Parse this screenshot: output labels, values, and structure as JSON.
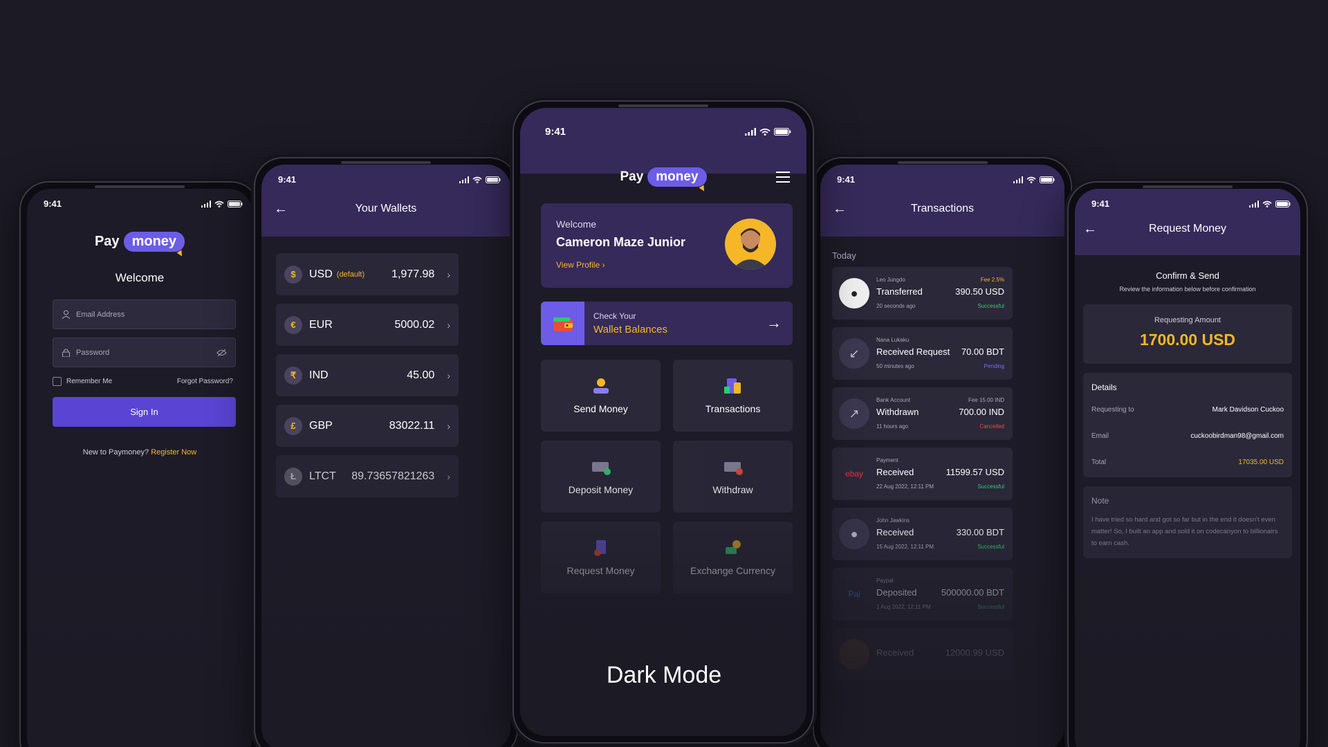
{
  "caption": "Dark Mode",
  "status_time": "9:41",
  "logo": {
    "pay": "Pay",
    "money": "money"
  },
  "login": {
    "welcome": "Welcome",
    "email_placeholder": "Email Address",
    "password_placeholder": "Password",
    "remember": "Remember Me",
    "forgot": "Forgot Password?",
    "sign_in": "Sign In",
    "new_text": "New to Paymoney?",
    "register": "Register Now"
  },
  "wallets": {
    "title": "Your Wallets",
    "items": [
      {
        "symbol": "$",
        "code": "USD",
        "tag": "(default)",
        "amount": "1,977.98"
      },
      {
        "symbol": "€",
        "code": "EUR",
        "tag": "",
        "amount": "5000.02"
      },
      {
        "symbol": "₹",
        "code": "IND",
        "tag": "",
        "amount": "45.00"
      },
      {
        "symbol": "£",
        "code": "GBP",
        "tag": "",
        "amount": "83022.11"
      },
      {
        "symbol": "Ł",
        "code": "LTCT",
        "tag": "",
        "amount": "89.73657821263"
      }
    ]
  },
  "home": {
    "welcome": "Welcome",
    "name": "Cameron Maze Junior",
    "view_profile": "View Profile ›",
    "check_your": "Check Your",
    "wallet_balances": "Wallet Balances",
    "actions": [
      "Send Money",
      "Transactions",
      "Deposit Money",
      "Withdraw",
      "Request Money",
      "Exchange Currency"
    ]
  },
  "transactions": {
    "title": "Transactions",
    "section": "Today",
    "items": [
      {
        "party": "Leo Jungdo",
        "type": "Transferred",
        "time": "20 seconds ago",
        "fee": "Fee 2.5%",
        "amount": "390.50 USD",
        "status": "Successful"
      },
      {
        "party": "Nana Lukaku",
        "type": "Received Request",
        "time": "50 minutes ago",
        "fee": "",
        "amount": "70.00 BDT",
        "status": "Pending"
      },
      {
        "party": "Bank Account",
        "type": "Withdrawn",
        "time": "11 hours ago",
        "fee": "Fee 15.00 IND",
        "amount": "700.00 IND",
        "status": "Cancelled"
      },
      {
        "party": "Payment",
        "type": "Received",
        "time": "22 Aug 2022, 12:11 PM",
        "fee": "",
        "amount": "11599.57 USD",
        "status": "Successful"
      },
      {
        "party": "John Jawkins",
        "type": "Received",
        "time": "15 Aug 2022, 12:11 PM",
        "fee": "",
        "amount": "330.00 BDT",
        "status": "Successful"
      },
      {
        "party": "Paypal",
        "type": "Deposited",
        "time": "1 Aug 2022, 12:11 PM",
        "fee": "",
        "amount": "500000.00 BDT",
        "status": "Successful"
      },
      {
        "party": "",
        "type": "Received",
        "time": "",
        "fee": "",
        "amount": "12000.99 USD",
        "status": ""
      }
    ]
  },
  "request": {
    "title": "Request Money",
    "confirm": "Confirm & Send",
    "confirm_sub": "Review the information below before confirmation",
    "req_label": "Requesting Amount",
    "req_amount": "1700.00 USD",
    "details": "Details",
    "rows": [
      {
        "label": "Requesting to",
        "value": "Mark Davidson Cuckoo"
      },
      {
        "label": "Email",
        "value": "cuckoobirdman98@gmail.com"
      },
      {
        "label": "Total",
        "value": "17035.00 USD"
      }
    ],
    "note_label": "Note",
    "note_text": "I have tried so hard and got so far but in the end it doesn't even matter! So, I built an app and sold it on codecanyon to billionairs to earn cash."
  },
  "colors": {
    "bg": "#1c1a24",
    "accent": "#6c5ce7",
    "gold": "#f5b728",
    "header": "#352a5a",
    "success": "#2ecc71",
    "pending": "#7b6cff",
    "cancel": "#e74c3c"
  }
}
